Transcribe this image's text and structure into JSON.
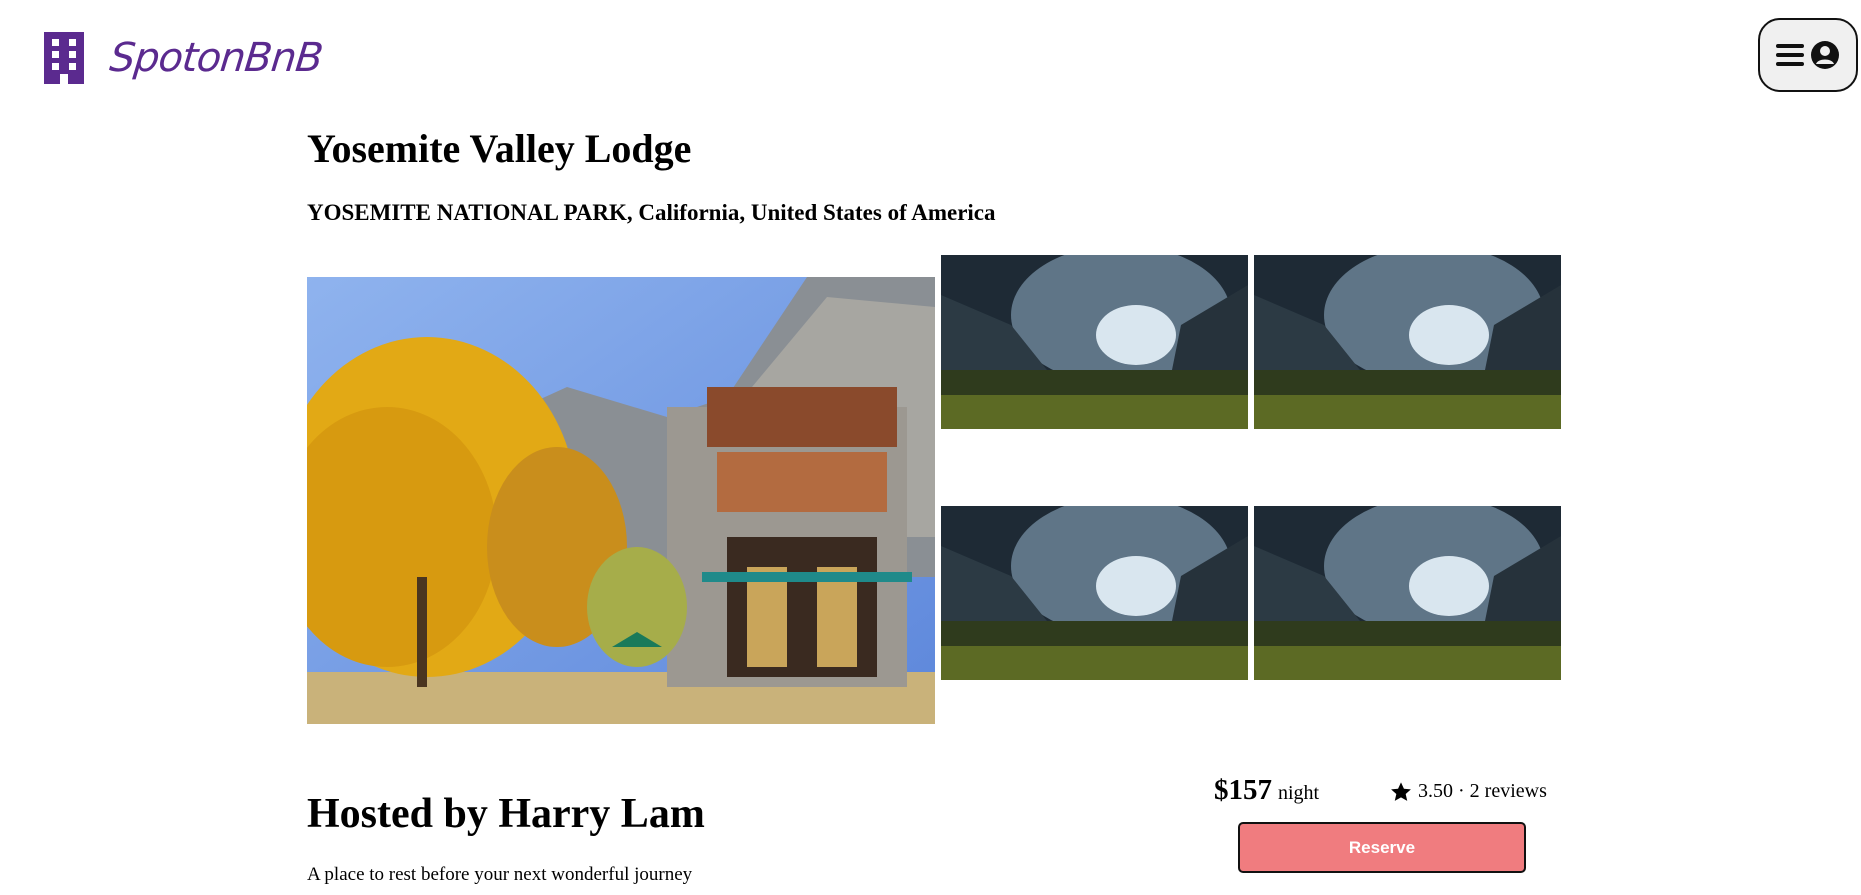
{
  "brand": {
    "name": "SpotonBnB",
    "color": "#5b2a8f"
  },
  "header": {
    "menu_icon": "hamburger-menu-icon",
    "avatar_icon": "user-circle-icon"
  },
  "listing": {
    "title": "Yosemite Valley Lodge",
    "location": "YOSEMITE NATIONAL PARK, California, United States of America",
    "host_heading": "Hosted by Harry Lam",
    "description": "A place to rest before your next wonderful journey"
  },
  "booking": {
    "price": "$157",
    "per_unit": "night",
    "rating": "3.50 · 2 reviews",
    "reserve_label": "Reserve",
    "accent": "#f07c7f"
  }
}
